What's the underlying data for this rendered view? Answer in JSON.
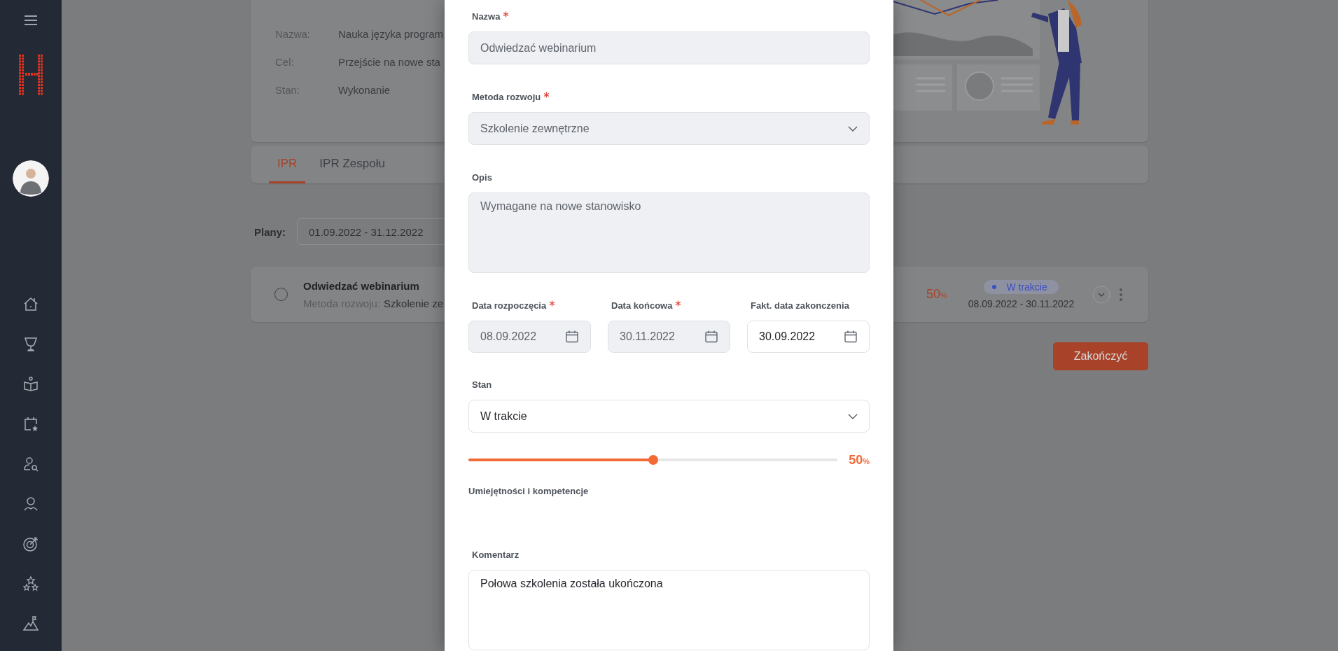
{
  "info": {
    "rows": [
      {
        "label": "Nazwa:",
        "value": "Nauka języka program"
      },
      {
        "label": "Cel:",
        "value": "Przejście na nowe sta"
      },
      {
        "label": "Stan:",
        "value": "Wykonanie"
      }
    ]
  },
  "tabs": [
    {
      "label": "IPR",
      "selected": true
    },
    {
      "label": "IPR Zespołu",
      "selected": false
    }
  ],
  "plans": {
    "label": "Plany:",
    "value": "01.09.2022 - 31.12.2022"
  },
  "tasks": [
    {
      "title": "Odwiedzać webinarium",
      "checked": false,
      "method_label": "Metoda rozwoju:",
      "method": "Szkolenie ze",
      "progress": "50",
      "unit": "%",
      "status": {
        "label": "W trakcie",
        "color": "#3b4fc4"
      },
      "dates": "08.09.2022 - 30.11.2022"
    }
  ],
  "finish_button": "Zakończyć",
  "modal": {
    "fields": [
      {
        "kind": "text",
        "label": "Nazwa",
        "required": true,
        "value": "Odwiedzać webinarium",
        "disabled": true
      },
      {
        "kind": "select",
        "label": "Metoda rozwoju",
        "required": true,
        "value": "Szkolenie zewnętrzne",
        "disabled": true
      },
      {
        "kind": "textarea",
        "label": "Opis",
        "required": false,
        "value": "Wymagane na nowe stanowisko",
        "disabled": true
      },
      {
        "kind": "dates",
        "items": [
          {
            "label": "Data rozpoczęcia",
            "required": true,
            "value": "08.09.2022",
            "disabled": true
          },
          {
            "label": "Data końcowa",
            "required": true,
            "value": "30.11.2022",
            "disabled": true
          },
          {
            "label": "Fakt. data zakonczenia",
            "required": false,
            "value": "30.09.2022",
            "disabled": false
          }
        ]
      },
      {
        "kind": "select",
        "label": "Stan",
        "required": false,
        "value": "W trakcie",
        "disabled": false
      },
      {
        "kind": "slider",
        "level": 0.5,
        "reading": "50",
        "unit": "%"
      },
      {
        "kind": "heading",
        "label": "Umiejętności i kompetencje"
      },
      {
        "kind": "textarea",
        "label": "Komentarz",
        "required": false,
        "value": "Połowa szkolenia została ukończona",
        "disabled": false
      }
    ]
  }
}
